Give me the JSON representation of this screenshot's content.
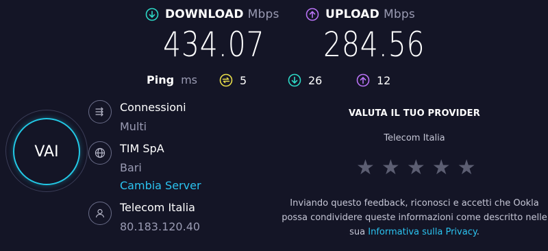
{
  "download": {
    "label": "DOWNLOAD",
    "unit": "Mbps",
    "value": "434.07",
    "icon": "download-arrow-icon",
    "color": "#2dd8c6"
  },
  "upload": {
    "label": "UPLOAD",
    "unit": "Mbps",
    "value": "284.56",
    "icon": "upload-arrow-icon",
    "color": "#b872f4"
  },
  "ping": {
    "label": "Ping",
    "unit": "ms",
    "idle": "5",
    "download": "26",
    "upload": "12",
    "idle_color": "#e9de4a"
  },
  "go_button": {
    "label": "VAI",
    "accent": "#22c9e6"
  },
  "connections": {
    "title": "Connessioni",
    "value": "Multi",
    "icon": "connections-arrows-icon"
  },
  "server": {
    "title": "TIM SpA",
    "location": "Bari",
    "change_link": "Cambia Server",
    "icon": "globe-icon"
  },
  "provider": {
    "title": "Telecom Italia",
    "ip": "80.183.120.40",
    "icon": "user-icon"
  },
  "rating": {
    "title": "VALUTA IL TUO PROVIDER",
    "provider_name": "Telecom Italia",
    "stars": 5,
    "disclaimer_before": "Inviando questo feedback, riconosci e accetti che Ookla possa condividere queste informazioni come descritto nelle sua ",
    "disclaimer_link": "Informativa sulla Privacy",
    "disclaimer_after": "."
  },
  "colors": {
    "background": "#141526",
    "link": "#2bc3f0",
    "muted_text": "#9a9bb3"
  }
}
